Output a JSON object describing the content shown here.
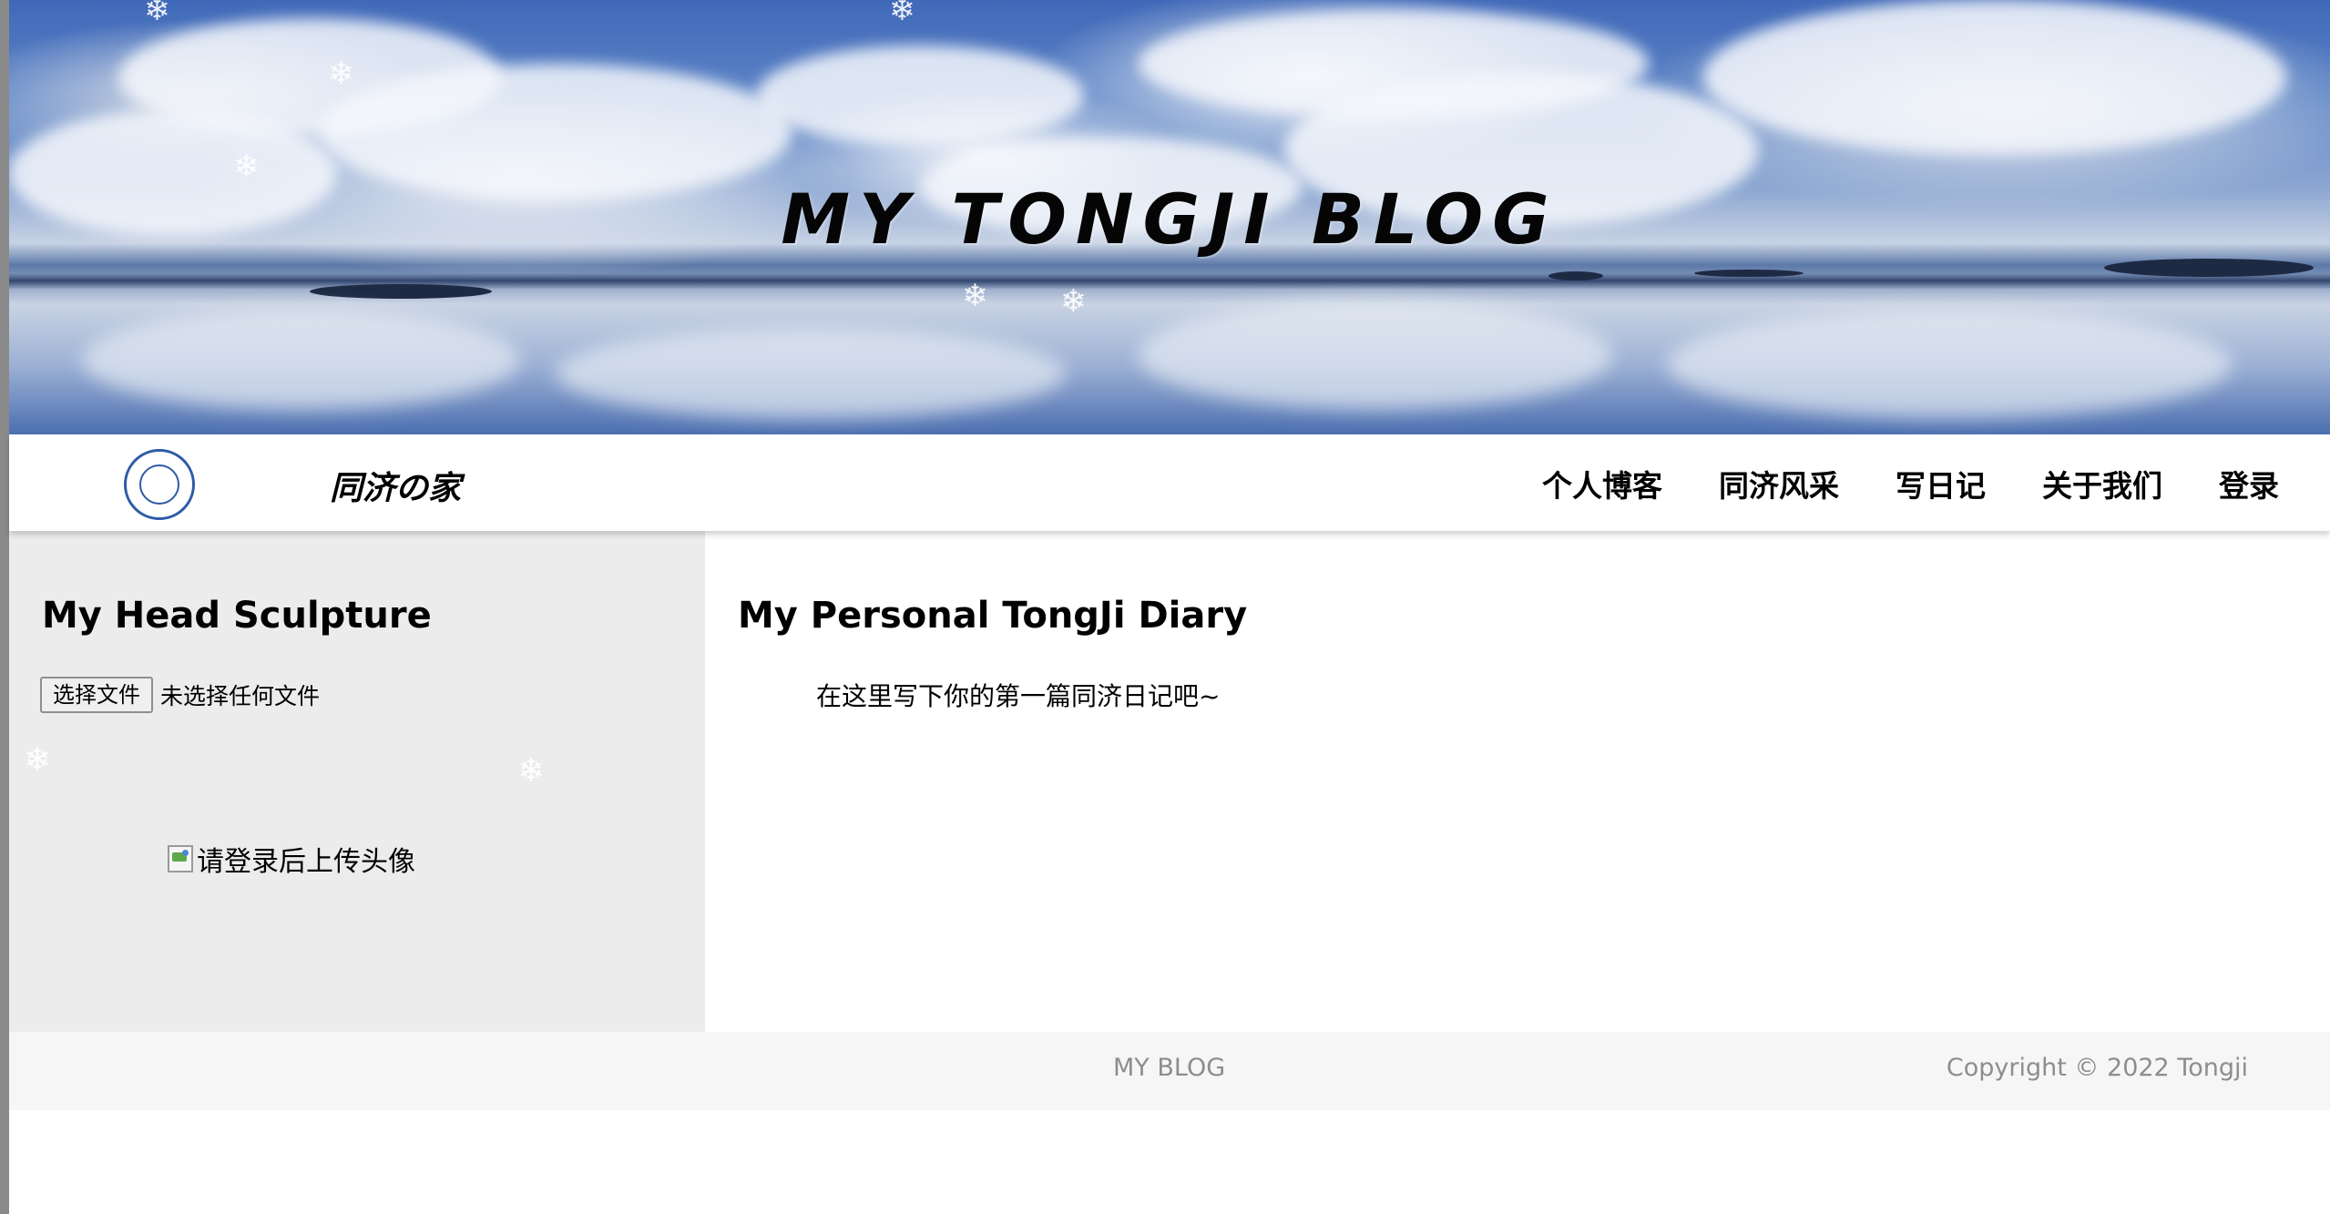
{
  "header": {
    "title": "MY TONGJI BLOG"
  },
  "nav": {
    "brand": "同济の家",
    "logo_icon": "tongji-university-logo",
    "items": [
      {
        "label": "个人博客"
      },
      {
        "label": "同济风采"
      },
      {
        "label": "写日记"
      },
      {
        "label": "关于我们"
      },
      {
        "label": "登录"
      }
    ]
  },
  "sidebar": {
    "title": "My Head Sculpture",
    "file_button": "选择文件",
    "file_status": "未选择任何文件",
    "avatar_alt": "请登录后上传头像"
  },
  "main": {
    "title": "My Personal TongJi Diary",
    "text": "在这里写下你的第一篇同济日记吧~"
  },
  "footer": {
    "brand": "MY BLOG",
    "copyright": "Copyright © 2022 Tongji"
  },
  "colors": {
    "sidebar_bg": "#ececec",
    "footer_bg": "#f6f6f6",
    "footer_text": "#8d8d8d",
    "logo_blue": "#2f5aa8"
  }
}
